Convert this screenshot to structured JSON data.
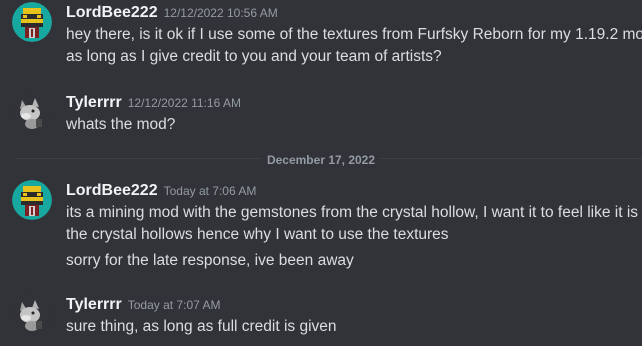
{
  "colors": {
    "background": "#313338",
    "username": "#f2f3f5",
    "timestamp": "#949ba4",
    "message_text": "#dbdee1",
    "divider_line": "#3f4147",
    "bee_avatar_bg": "#17a8a0"
  },
  "messages": [
    {
      "author": "LordBee222",
      "avatar_icon": "bee-avatar-icon",
      "timestamp": "12/12/2022 10:56 AM",
      "lines": [
        "hey there, is it ok if I use some of the textures from Furfsky Reborn for my 1.19.2 mod",
        "as long as I give credit to you and your team of artists?"
      ]
    },
    {
      "author": "Tylerrrr",
      "avatar_icon": "wolf-avatar-icon",
      "timestamp": "12/12/2022 11:16 AM",
      "lines": [
        "whats the mod?"
      ]
    },
    {
      "author": "LordBee222",
      "avatar_icon": "bee-avatar-icon",
      "timestamp": "Today at 7:06 AM",
      "lines": [
        "its a mining mod with the gemstones from the crystal hollow, I want it to feel like it is",
        "the crystal hollows hence why I want to use the textures",
        "sorry for the late response, ive been away"
      ]
    },
    {
      "author": "Tylerrrr",
      "avatar_icon": "wolf-avatar-icon",
      "timestamp": "Today at 7:07 AM",
      "lines": [
        "sure thing, as long as full credit is given"
      ]
    }
  ],
  "date_divider": "December 17, 2022"
}
